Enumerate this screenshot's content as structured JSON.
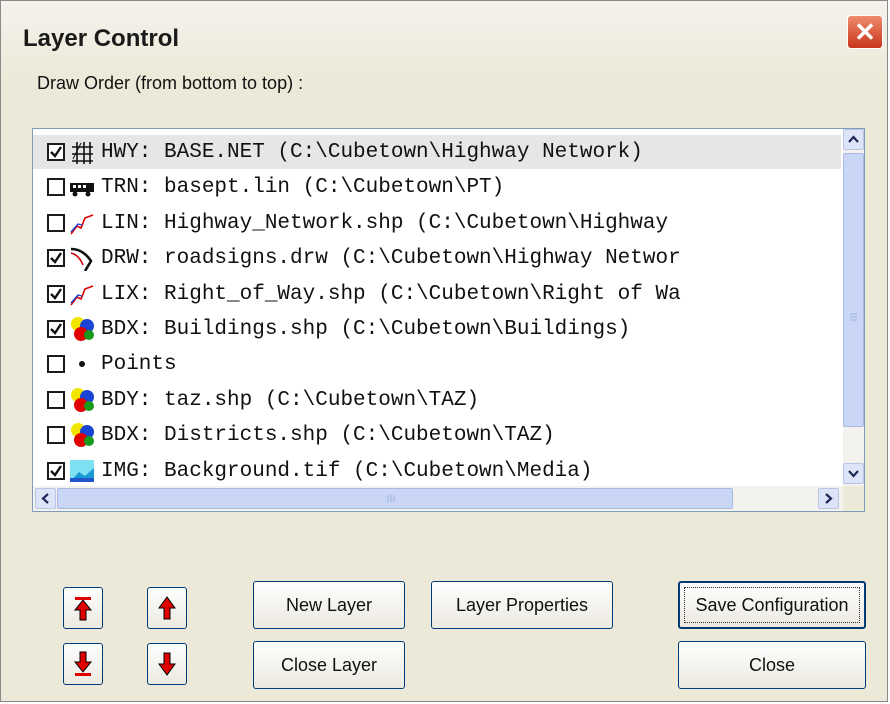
{
  "window": {
    "title": "Layer Control",
    "close_glyph": "✕"
  },
  "subtitle": "Draw Order (from bottom to top) :",
  "layers": [
    {
      "checked": true,
      "icon": "grid-network-icon",
      "label": "HWY: BASE.NET (C:\\Cubetown\\Highway Network)",
      "selected": true
    },
    {
      "checked": false,
      "icon": "bus-icon",
      "label": "TRN: basept.lin (C:\\Cubetown\\PT)",
      "selected": false
    },
    {
      "checked": false,
      "icon": "polyline-icon",
      "label": "LIN: Highway_Network.shp (C:\\Cubetown\\Highway",
      "selected": false
    },
    {
      "checked": true,
      "icon": "drawing-curve-icon",
      "label": "DRW: roadsigns.drw (C:\\Cubetown\\Highway Networ",
      "selected": false
    },
    {
      "checked": true,
      "icon": "polyline-icon",
      "label": "LIX: Right_of_Way.shp (C:\\Cubetown\\Right of Wa",
      "selected": false
    },
    {
      "checked": true,
      "icon": "polygon-icon",
      "label": "BDX: Buildings.shp (C:\\Cubetown\\Buildings)",
      "selected": false
    },
    {
      "checked": false,
      "icon": "point-icon",
      "label": "Points",
      "selected": false
    },
    {
      "checked": false,
      "icon": "polygon-icon",
      "label": "BDY: taz.shp (C:\\Cubetown\\TAZ)",
      "selected": false
    },
    {
      "checked": false,
      "icon": "polygon-icon",
      "label": "BDX: Districts.shp (C:\\Cubetown\\TAZ)",
      "selected": false
    },
    {
      "checked": true,
      "icon": "image-icon",
      "label": "IMG: Background.tif (C:\\Cubetown\\Media)",
      "selected": false
    }
  ],
  "buttons": {
    "new_layer": "New Layer",
    "layer_properties": "Layer Properties",
    "save_configuration": "Save Configuration",
    "close_layer": "Close Layer",
    "close": "Close"
  },
  "colors": {
    "dialog_bg": "#ece9d8",
    "close_red": "#c8351c",
    "arrow_red": "#e00000",
    "button_border": "#003c74",
    "scroll_thumb": "#c9d6f6"
  }
}
